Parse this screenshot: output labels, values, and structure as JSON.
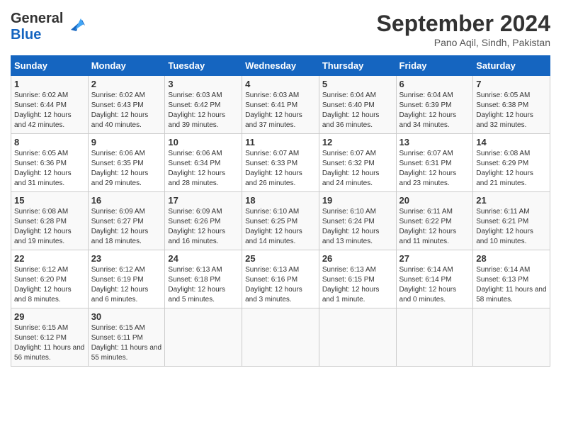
{
  "header": {
    "logo_line1": "General",
    "logo_line2": "Blue",
    "month_title": "September 2024",
    "location": "Pano Aqil, Sindh, Pakistan"
  },
  "calendar": {
    "weekdays": [
      "Sunday",
      "Monday",
      "Tuesday",
      "Wednesday",
      "Thursday",
      "Friday",
      "Saturday"
    ],
    "weeks": [
      [
        null,
        {
          "day": "2",
          "sunrise": "6:02 AM",
          "sunset": "6:43 PM",
          "daylight": "12 hours and 40 minutes."
        },
        {
          "day": "3",
          "sunrise": "6:03 AM",
          "sunset": "6:42 PM",
          "daylight": "12 hours and 39 minutes."
        },
        {
          "day": "4",
          "sunrise": "6:03 AM",
          "sunset": "6:41 PM",
          "daylight": "12 hours and 37 minutes."
        },
        {
          "day": "5",
          "sunrise": "6:04 AM",
          "sunset": "6:40 PM",
          "daylight": "12 hours and 36 minutes."
        },
        {
          "day": "6",
          "sunrise": "6:04 AM",
          "sunset": "6:39 PM",
          "daylight": "12 hours and 34 minutes."
        },
        {
          "day": "7",
          "sunrise": "6:05 AM",
          "sunset": "6:38 PM",
          "daylight": "12 hours and 32 minutes."
        }
      ],
      [
        {
          "day": "1",
          "sunrise": "6:02 AM",
          "sunset": "6:44 PM",
          "daylight": "12 hours and 42 minutes."
        },
        null,
        null,
        null,
        null,
        null,
        null
      ],
      [
        {
          "day": "8",
          "sunrise": "6:05 AM",
          "sunset": "6:36 PM",
          "daylight": "12 hours and 31 minutes."
        },
        {
          "day": "9",
          "sunrise": "6:06 AM",
          "sunset": "6:35 PM",
          "daylight": "12 hours and 29 minutes."
        },
        {
          "day": "10",
          "sunrise": "6:06 AM",
          "sunset": "6:34 PM",
          "daylight": "12 hours and 28 minutes."
        },
        {
          "day": "11",
          "sunrise": "6:07 AM",
          "sunset": "6:33 PM",
          "daylight": "12 hours and 26 minutes."
        },
        {
          "day": "12",
          "sunrise": "6:07 AM",
          "sunset": "6:32 PM",
          "daylight": "12 hours and 24 minutes."
        },
        {
          "day": "13",
          "sunrise": "6:07 AM",
          "sunset": "6:31 PM",
          "daylight": "12 hours and 23 minutes."
        },
        {
          "day": "14",
          "sunrise": "6:08 AM",
          "sunset": "6:29 PM",
          "daylight": "12 hours and 21 minutes."
        }
      ],
      [
        {
          "day": "15",
          "sunrise": "6:08 AM",
          "sunset": "6:28 PM",
          "daylight": "12 hours and 19 minutes."
        },
        {
          "day": "16",
          "sunrise": "6:09 AM",
          "sunset": "6:27 PM",
          "daylight": "12 hours and 18 minutes."
        },
        {
          "day": "17",
          "sunrise": "6:09 AM",
          "sunset": "6:26 PM",
          "daylight": "12 hours and 16 minutes."
        },
        {
          "day": "18",
          "sunrise": "6:10 AM",
          "sunset": "6:25 PM",
          "daylight": "12 hours and 14 minutes."
        },
        {
          "day": "19",
          "sunrise": "6:10 AM",
          "sunset": "6:24 PM",
          "daylight": "12 hours and 13 minutes."
        },
        {
          "day": "20",
          "sunrise": "6:11 AM",
          "sunset": "6:22 PM",
          "daylight": "12 hours and 11 minutes."
        },
        {
          "day": "21",
          "sunrise": "6:11 AM",
          "sunset": "6:21 PM",
          "daylight": "12 hours and 10 minutes."
        }
      ],
      [
        {
          "day": "22",
          "sunrise": "6:12 AM",
          "sunset": "6:20 PM",
          "daylight": "12 hours and 8 minutes."
        },
        {
          "day": "23",
          "sunrise": "6:12 AM",
          "sunset": "6:19 PM",
          "daylight": "12 hours and 6 minutes."
        },
        {
          "day": "24",
          "sunrise": "6:13 AM",
          "sunset": "6:18 PM",
          "daylight": "12 hours and 5 minutes."
        },
        {
          "day": "25",
          "sunrise": "6:13 AM",
          "sunset": "6:16 PM",
          "daylight": "12 hours and 3 minutes."
        },
        {
          "day": "26",
          "sunrise": "6:13 AM",
          "sunset": "6:15 PM",
          "daylight": "12 hours and 1 minute."
        },
        {
          "day": "27",
          "sunrise": "6:14 AM",
          "sunset": "6:14 PM",
          "daylight": "12 hours and 0 minutes."
        },
        {
          "day": "28",
          "sunrise": "6:14 AM",
          "sunset": "6:13 PM",
          "daylight": "11 hours and 58 minutes."
        }
      ],
      [
        {
          "day": "29",
          "sunrise": "6:15 AM",
          "sunset": "6:12 PM",
          "daylight": "11 hours and 56 minutes."
        },
        {
          "day": "30",
          "sunrise": "6:15 AM",
          "sunset": "6:11 PM",
          "daylight": "11 hours and 55 minutes."
        },
        null,
        null,
        null,
        null,
        null
      ]
    ]
  }
}
